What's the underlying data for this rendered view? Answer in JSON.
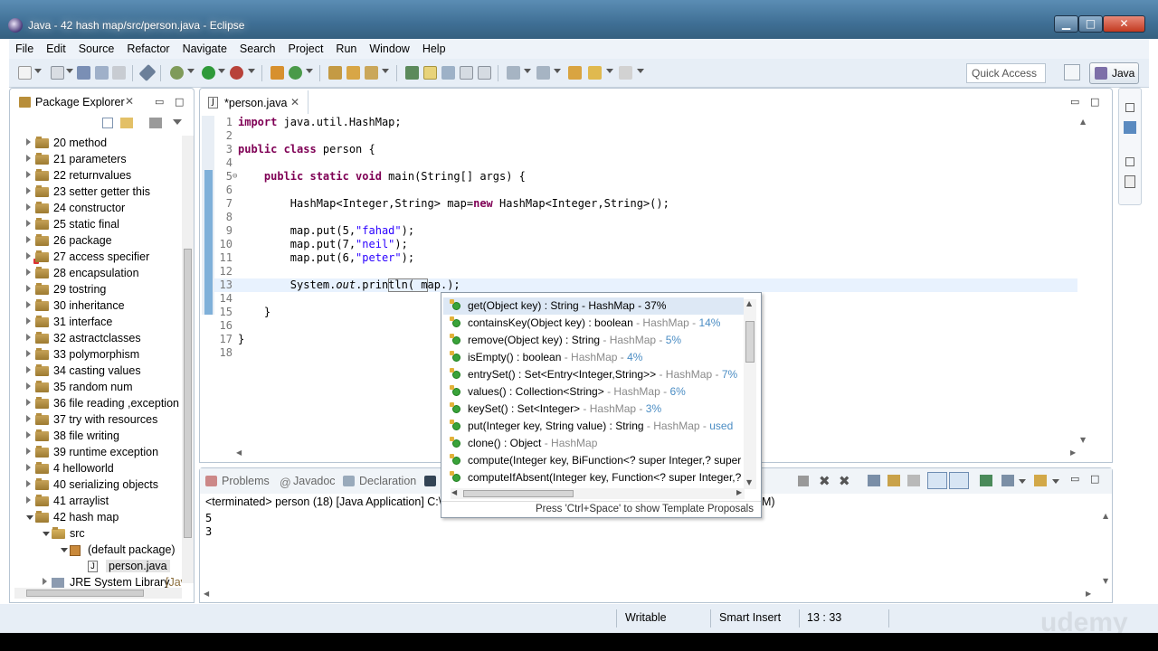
{
  "window": {
    "title": "Java - 42 hash map/src/person.java - Eclipse",
    "min": "▁",
    "max": "□",
    "close": "✕"
  },
  "menu": [
    "File",
    "Edit",
    "Source",
    "Refactor",
    "Navigate",
    "Search",
    "Project",
    "Run",
    "Window",
    "Help"
  ],
  "toolbar": {
    "quick_access": "Quick Access",
    "perspective": "Java"
  },
  "package_explorer": {
    "title": "Package Explorer",
    "items": [
      {
        "label": "20 method",
        "level": 0,
        "kind": "project"
      },
      {
        "label": "21 parameters",
        "level": 0,
        "kind": "project"
      },
      {
        "label": "22 returnvalues",
        "level": 0,
        "kind": "project"
      },
      {
        "label": "23 setter getter this",
        "level": 0,
        "kind": "project"
      },
      {
        "label": "24 constructor",
        "level": 0,
        "kind": "project"
      },
      {
        "label": "25 static final",
        "level": 0,
        "kind": "project"
      },
      {
        "label": "26 package",
        "level": 0,
        "kind": "project"
      },
      {
        "label": "27 access specifier",
        "level": 0,
        "kind": "project"
      },
      {
        "label": "28 encapsulation",
        "level": 0,
        "kind": "project"
      },
      {
        "label": "29 tostring",
        "level": 0,
        "kind": "project"
      },
      {
        "label": "30 inheritance",
        "level": 0,
        "kind": "project"
      },
      {
        "label": "31 interface",
        "level": 0,
        "kind": "project"
      },
      {
        "label": "32 astractclasses",
        "level": 0,
        "kind": "project"
      },
      {
        "label": "33 polymorphism",
        "level": 0,
        "kind": "project"
      },
      {
        "label": "34 casting values",
        "level": 0,
        "kind": "project"
      },
      {
        "label": "35 random num",
        "level": 0,
        "kind": "project"
      },
      {
        "label": "36 file reading ,exception h",
        "level": 0,
        "kind": "project"
      },
      {
        "label": "37 try with resources",
        "level": 0,
        "kind": "project"
      },
      {
        "label": "38 file writing",
        "level": 0,
        "kind": "project"
      },
      {
        "label": "39 runtime exception",
        "level": 0,
        "kind": "project"
      },
      {
        "label": "4 helloworld",
        "level": 0,
        "kind": "project"
      },
      {
        "label": "40 serializing objects",
        "level": 0,
        "kind": "project"
      },
      {
        "label": "41 arraylist",
        "level": 0,
        "kind": "project"
      },
      {
        "label": "42 hash map",
        "level": 0,
        "kind": "project",
        "open": true
      },
      {
        "label": "src",
        "level": 1,
        "kind": "src",
        "open": true
      },
      {
        "label": "(default package)",
        "level": 2,
        "kind": "package",
        "open": true
      },
      {
        "label": "person.java",
        "level": 3,
        "kind": "file",
        "selected": true
      },
      {
        "label": "JRE System Library",
        "suffix": "[Jav",
        "level": 1,
        "kind": "lib"
      }
    ]
  },
  "editor": {
    "tab": "*person.java",
    "lines": [
      {
        "n": "1",
        "html": "<span class='kw'>import</span> java.util.HashMap;"
      },
      {
        "n": "2",
        "html": ""
      },
      {
        "n": "3",
        "html": "<span class='kw'>public class</span> person {"
      },
      {
        "n": "4",
        "html": ""
      },
      {
        "n": "5",
        "html": "    <span class='kw'>public static void</span> main(String[] args) {"
      },
      {
        "n": "6",
        "html": ""
      },
      {
        "n": "7",
        "html": "        HashMap&lt;Integer,String&gt; map=<span class='kw'>new</span> HashMap&lt;Integer,String&gt;();"
      },
      {
        "n": "8",
        "html": ""
      },
      {
        "n": "9",
        "html": "        map.put(5,<span class='str'>\"fahad\"</span>);"
      },
      {
        "n": "10",
        "html": "        map.put(7,<span class='str'>\"neil\"</span>);"
      },
      {
        "n": "11",
        "html": "        map.put(6,<span class='str'>\"peter\"</span>);"
      },
      {
        "n": "12",
        "html": ""
      },
      {
        "n": "13",
        "html": "        System.<span class='fld stat'>out</span>.println( map.);"
      },
      {
        "n": "14",
        "html": ""
      },
      {
        "n": "15",
        "html": "    }"
      },
      {
        "n": "16",
        "html": ""
      },
      {
        "n": "17",
        "html": "}"
      },
      {
        "n": "18",
        "html": ""
      }
    ]
  },
  "content_assist": {
    "items": [
      {
        "sig": "get(Object key) : String - HashMap - 37%",
        "owner": "",
        "pct": "",
        "selected": true
      },
      {
        "sig": "containsKey(Object key) : boolean",
        "owner": " - HashMap - ",
        "pct": "14%"
      },
      {
        "sig": "remove(Object key) : String",
        "owner": " - HashMap - ",
        "pct": "5%"
      },
      {
        "sig": "isEmpty() : boolean",
        "owner": " - HashMap - ",
        "pct": "4%"
      },
      {
        "sig": "entrySet() : Set<Entry<Integer,String>>",
        "owner": " - HashMap - ",
        "pct": "7%"
      },
      {
        "sig": "values() : Collection<String>",
        "owner": " - HashMap - ",
        "pct": "6%"
      },
      {
        "sig": "keySet() : Set<Integer>",
        "owner": " - HashMap - ",
        "pct": "3%"
      },
      {
        "sig": "put(Integer key, String value) : String",
        "owner": " - HashMap - ",
        "pct": "used"
      },
      {
        "sig": "clone() : Object",
        "owner": " - HashMap",
        "pct": ""
      },
      {
        "sig": "compute(Integer key, BiFunction<? super Integer,? super",
        "owner": "",
        "pct": ""
      },
      {
        "sig": "computeIfAbsent(Integer key, Function<? super Integer,?",
        "owner": "",
        "pct": ""
      }
    ],
    "footer": "Press 'Ctrl+Space' to show Template Proposals"
  },
  "console": {
    "tabs": [
      "Problems",
      "Javadoc",
      "Declaration"
    ],
    "status": "<terminated> person (18) [Java Application] C:\\Pr",
    "status_tail": "M)",
    "output": [
      "5",
      "3"
    ]
  },
  "statusbar": {
    "writable": "Writable",
    "insert_mode": "Smart Insert",
    "position": "13 : 33"
  },
  "watermark": "udemy"
}
